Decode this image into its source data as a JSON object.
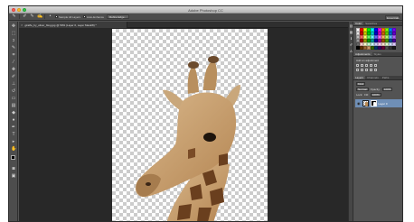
{
  "app": {
    "window_title": "Adobe Photoshop CC"
  },
  "options_bar": {
    "sample_all_layers_label": "Sample All Layers",
    "auto_enhance_label": "Auto-Enhance",
    "refine_edge_label": "Refine Edge...",
    "workspace_label": "Essentials"
  },
  "document": {
    "tab_title": "giraffe_by_oliver_blog.jpg @ 50% (Layer 0, Layer Mask/8) *"
  },
  "panels": {
    "color_tabs": [
      "Color",
      "Swatches"
    ],
    "adjust_tabs": [
      "Adjustments",
      "Styles"
    ],
    "add_adjustment_label": "Add an adjustment",
    "layers_tabs": [
      "Layers",
      "Channels",
      "Paths"
    ],
    "kind_label": "Kind",
    "blend_mode": "Normal",
    "opacity_label": "Opacity:",
    "opacity_value": "100%",
    "lock_label": "Lock:",
    "fill_label": "Fill:",
    "fill_value": "100%",
    "layer_name": "Layer 0"
  },
  "colors": {
    "swatches": [
      "#ffffff",
      "#ff0000",
      "#ffff00",
      "#00ff00",
      "#00ffff",
      "#0000ff",
      "#ff00ff",
      "#ff8000",
      "#80ff00",
      "#0080ff",
      "#8000ff",
      "#e6e6e6",
      "#cc0000",
      "#cccc00",
      "#00cc00",
      "#00cccc",
      "#0000cc",
      "#cc00cc",
      "#cc6600",
      "#66cc00",
      "#0066cc",
      "#6600cc",
      "#bfbfbf",
      "#ff6666",
      "#ffff66",
      "#66ff66",
      "#66ffff",
      "#6666ff",
      "#ff66ff",
      "#ffb366",
      "#b3ff66",
      "#66b3ff",
      "#b366ff",
      "#999999",
      "#990000",
      "#999900",
      "#009900",
      "#009999",
      "#000099",
      "#990099",
      "#994c00",
      "#4c9900",
      "#004c99",
      "#4c0099",
      "#666666",
      "#ffcccc",
      "#ffffcc",
      "#ccffcc",
      "#ccffff",
      "#ccccff",
      "#ffccff",
      "#ffe0cc",
      "#e0ffcc",
      "#cce0ff",
      "#e0ccff",
      "#000000",
      "#663300",
      "#996633",
      "#cc9966",
      "#336600",
      "#003366",
      "#330066",
      "#660033",
      "#4d4d4d",
      "#333333",
      "#1a1a1a"
    ]
  }
}
